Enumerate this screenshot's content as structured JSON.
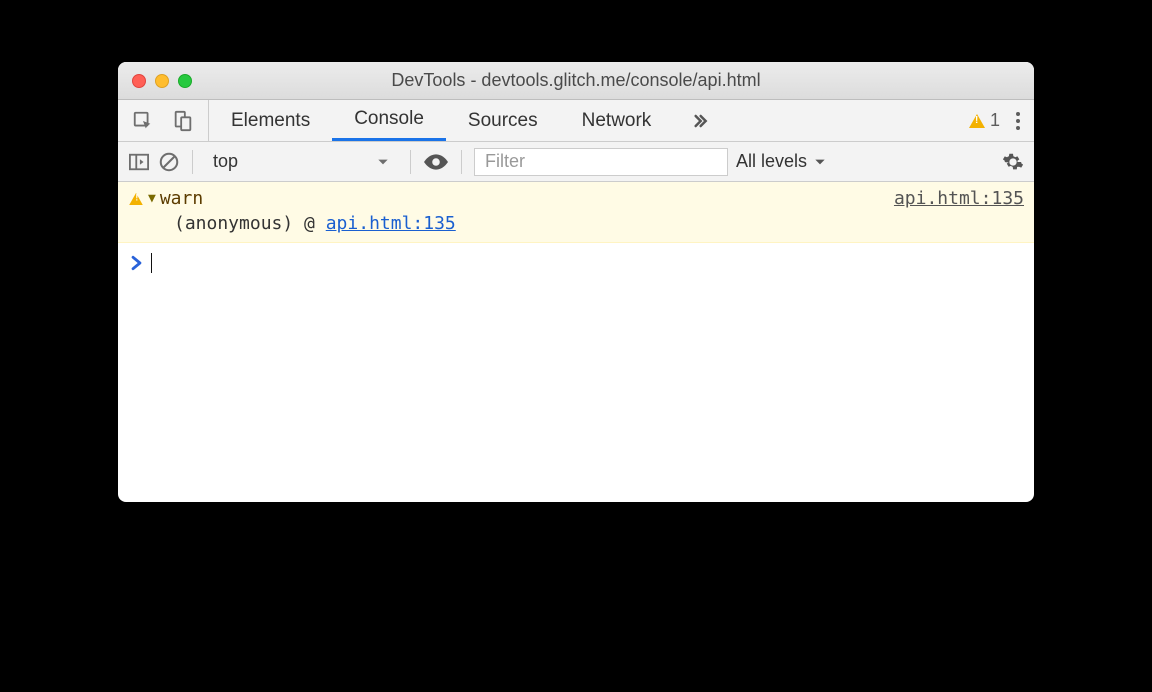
{
  "window": {
    "title": "DevTools - devtools.glitch.me/console/api.html"
  },
  "tabs": {
    "items": [
      "Elements",
      "Console",
      "Sources",
      "Network"
    ],
    "active": "Console",
    "warnings_count": "1"
  },
  "filter": {
    "context": "top",
    "placeholder": "Filter",
    "levels_label": "All levels"
  },
  "console": {
    "message": {
      "level": "warn",
      "label": "warn",
      "source": "api.html:135",
      "stack_prefix": "(anonymous) @ ",
      "stack_link": "api.html:135"
    }
  }
}
